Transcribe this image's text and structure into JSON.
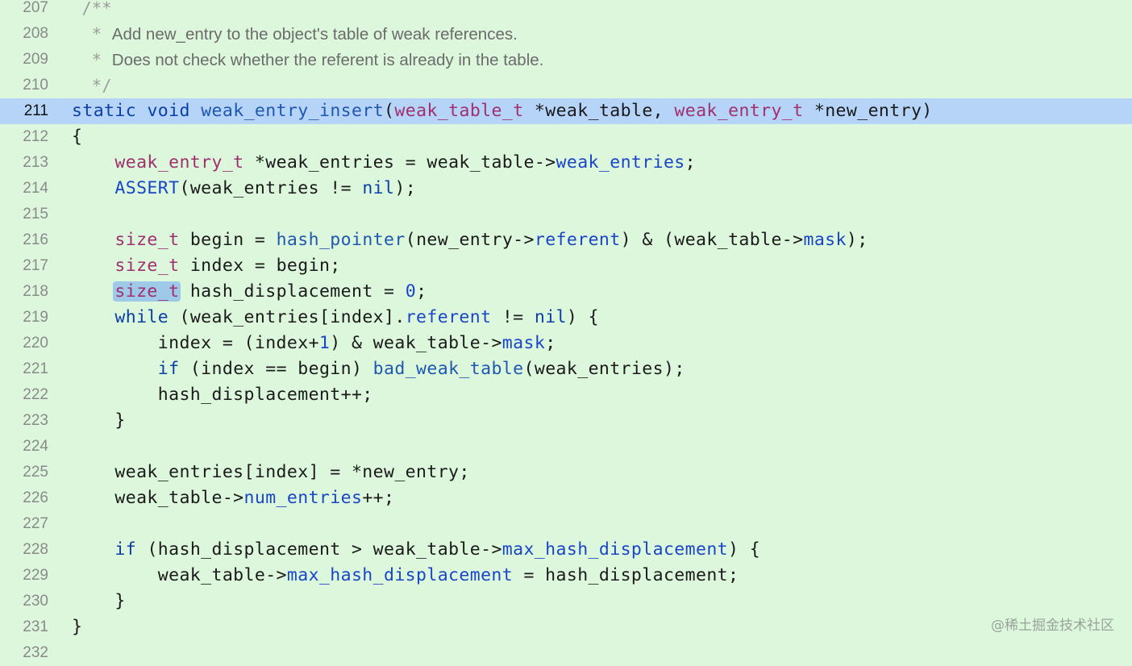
{
  "editor": {
    "current_line": "211",
    "lines": [
      {
        "n": "207",
        "segments": [
          {
            "c": "star",
            "t": " /**"
          }
        ]
      },
      {
        "n": "208",
        "segments": [
          {
            "c": "star",
            "t": "  * "
          },
          {
            "c": "cmt",
            "t": "Add new_entry to the object's table of weak references."
          }
        ]
      },
      {
        "n": "209",
        "segments": [
          {
            "c": "star",
            "t": "  * "
          },
          {
            "c": "cmt",
            "t": "Does not check whether the referent is already in the table."
          }
        ]
      },
      {
        "n": "210",
        "segments": [
          {
            "c": "star",
            "t": "  */"
          }
        ]
      },
      {
        "n": "211",
        "segments": [
          {
            "c": "kw",
            "t": "static"
          },
          {
            "c": "plain",
            "t": " "
          },
          {
            "c": "kw",
            "t": "void"
          },
          {
            "c": "plain",
            "t": " "
          },
          {
            "c": "fn",
            "t": "weak_entry_insert"
          },
          {
            "c": "plain",
            "t": "("
          },
          {
            "c": "ty",
            "t": "weak_table_t"
          },
          {
            "c": "plain",
            "t": " *weak_table, "
          },
          {
            "c": "ty",
            "t": "weak_entry_t"
          },
          {
            "c": "plain",
            "t": " *new_entry)"
          }
        ]
      },
      {
        "n": "212",
        "segments": [
          {
            "c": "plain",
            "t": "{"
          }
        ]
      },
      {
        "n": "213",
        "segments": [
          {
            "c": "plain",
            "t": "    "
          },
          {
            "c": "ty",
            "t": "weak_entry_t"
          },
          {
            "c": "plain",
            "t": " *weak_entries = weak_table->"
          },
          {
            "c": "mb",
            "t": "weak_entries"
          },
          {
            "c": "plain",
            "t": ";"
          }
        ]
      },
      {
        "n": "214",
        "segments": [
          {
            "c": "plain",
            "t": "    "
          },
          {
            "c": "mb",
            "t": "ASSERT"
          },
          {
            "c": "plain",
            "t": "(weak_entries != "
          },
          {
            "c": "kw",
            "t": "nil"
          },
          {
            "c": "plain",
            "t": ");"
          }
        ]
      },
      {
        "n": "215",
        "segments": []
      },
      {
        "n": "216",
        "segments": [
          {
            "c": "plain",
            "t": "    "
          },
          {
            "c": "ty",
            "t": "size_t"
          },
          {
            "c": "plain",
            "t": " begin = "
          },
          {
            "c": "fn",
            "t": "hash_pointer"
          },
          {
            "c": "plain",
            "t": "(new_entry->"
          },
          {
            "c": "mb",
            "t": "referent"
          },
          {
            "c": "plain",
            "t": ") & (weak_table->"
          },
          {
            "c": "mb",
            "t": "mask"
          },
          {
            "c": "plain",
            "t": ");"
          }
        ]
      },
      {
        "n": "217",
        "segments": [
          {
            "c": "plain",
            "t": "    "
          },
          {
            "c": "ty",
            "t": "size_t"
          },
          {
            "c": "plain",
            "t": " index = begin;"
          }
        ]
      },
      {
        "n": "218",
        "segments": [
          {
            "c": "plain",
            "t": "    "
          },
          {
            "c": "ty sel",
            "t": "size_t"
          },
          {
            "c": "plain",
            "t": " hash_displacement = "
          },
          {
            "c": "num",
            "t": "0"
          },
          {
            "c": "plain",
            "t": ";"
          }
        ]
      },
      {
        "n": "219",
        "segments": [
          {
            "c": "plain",
            "t": "    "
          },
          {
            "c": "kw",
            "t": "while"
          },
          {
            "c": "plain",
            "t": " (weak_entries[index]."
          },
          {
            "c": "mb",
            "t": "referent"
          },
          {
            "c": "plain",
            "t": " != "
          },
          {
            "c": "kw",
            "t": "nil"
          },
          {
            "c": "plain",
            "t": ") {"
          }
        ]
      },
      {
        "n": "220",
        "segments": [
          {
            "c": "plain",
            "t": "        index = (index+"
          },
          {
            "c": "num",
            "t": "1"
          },
          {
            "c": "plain",
            "t": ") & weak_table->"
          },
          {
            "c": "mb",
            "t": "mask"
          },
          {
            "c": "plain",
            "t": ";"
          }
        ]
      },
      {
        "n": "221",
        "segments": [
          {
            "c": "plain",
            "t": "        "
          },
          {
            "c": "kw",
            "t": "if"
          },
          {
            "c": "plain",
            "t": " (index == begin) "
          },
          {
            "c": "fn",
            "t": "bad_weak_table"
          },
          {
            "c": "plain",
            "t": "(weak_entries);"
          }
        ]
      },
      {
        "n": "222",
        "segments": [
          {
            "c": "plain",
            "t": "        hash_displacement++;"
          }
        ]
      },
      {
        "n": "223",
        "segments": [
          {
            "c": "plain",
            "t": "    }"
          }
        ]
      },
      {
        "n": "224",
        "segments": []
      },
      {
        "n": "225",
        "segments": [
          {
            "c": "plain",
            "t": "    weak_entries[index] = *new_entry;"
          }
        ]
      },
      {
        "n": "226",
        "segments": [
          {
            "c": "plain",
            "t": "    weak_table->"
          },
          {
            "c": "mb",
            "t": "num_entries"
          },
          {
            "c": "plain",
            "t": "++;"
          }
        ]
      },
      {
        "n": "227",
        "segments": []
      },
      {
        "n": "228",
        "segments": [
          {
            "c": "plain",
            "t": "    "
          },
          {
            "c": "kw",
            "t": "if"
          },
          {
            "c": "plain",
            "t": " (hash_displacement > weak_table->"
          },
          {
            "c": "mb",
            "t": "max_hash_displacement"
          },
          {
            "c": "plain",
            "t": ") {"
          }
        ]
      },
      {
        "n": "229",
        "segments": [
          {
            "c": "plain",
            "t": "        weak_table->"
          },
          {
            "c": "mb",
            "t": "max_hash_displacement"
          },
          {
            "c": "plain",
            "t": " = hash_displacement;"
          }
        ]
      },
      {
        "n": "230",
        "segments": [
          {
            "c": "plain",
            "t": "    }"
          }
        ]
      },
      {
        "n": "231",
        "segments": [
          {
            "c": "plain",
            "t": "}"
          }
        ]
      },
      {
        "n": "232",
        "segments": []
      }
    ]
  },
  "colors": {
    "background": "#dcf7dc",
    "current_line_highlight": "#b5d4f7",
    "keyword": "#0b3fa8",
    "type": "#a0306e",
    "member": "#1a45c8"
  },
  "watermark": "@稀土掘金技术社区"
}
